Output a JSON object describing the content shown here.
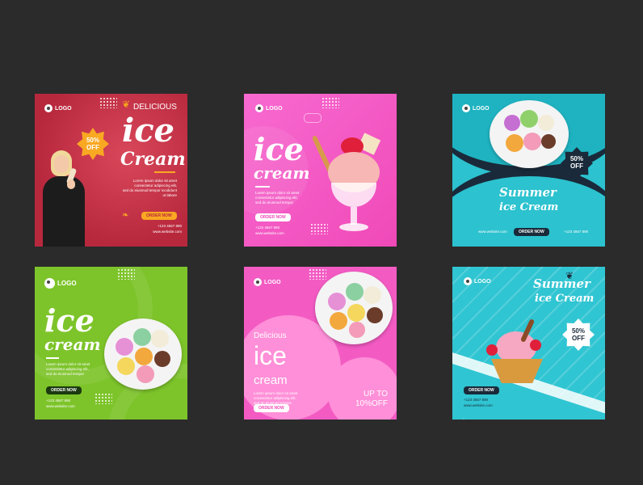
{
  "cards": [
    {
      "logo": "LOGO",
      "tag": "DELICIOUS",
      "badge_pct": "50%",
      "badge_off": "OFF",
      "title_1": "ice",
      "title_2": "Cream",
      "body_1": "Lorem ipsum dolor sit amet",
      "body_2": "consectetur adipiscing elit,",
      "body_3": "sed do eiusmod tempor incididunt",
      "body_4": "ut labore",
      "order": "ORDER NOW",
      "phone": "+123 4567 890",
      "website": "www.website.com"
    },
    {
      "logo": "LOGO",
      "title_1": "ice",
      "title_2": "cream",
      "body_1": "Lorem ipsum dolor sit amet",
      "body_2": "consectetur adipiscing elit,",
      "body_3": "sed do eiusmod tempor",
      "order": "ORDER NOW",
      "phone": "+123 4567 890",
      "website": "www.website.com"
    },
    {
      "logo": "LOGO",
      "badge_pct": "50%",
      "badge_off": "OFF",
      "title_1": "Summer",
      "title_2": "ice Cream",
      "website": "www.website.com",
      "order": "ORDER NOW",
      "phone": "+123 4567 890"
    },
    {
      "logo": "LOGO",
      "title_1": "ice",
      "title_2": "cream",
      "body_1": "Lorem ipsum dolor sit amet",
      "body_2": "consectetur adipiscing elit,",
      "body_3": "sed do eiusmod tempor",
      "order": "ORDER NOW",
      "phone": "+123 4567 890",
      "website": "www.website.com"
    },
    {
      "logo": "LOGO",
      "tag": "Delicious",
      "title_1": "ice",
      "title_2": "cream",
      "body_1": "Lorem ipsum dolor sit amet",
      "body_2": "consectetur adipiscing elit,",
      "body_3": "sed do eiusmod tempor",
      "promo_1": "UP TO",
      "promo_2": "10%OFF",
      "order": "ORDER NOW"
    },
    {
      "logo": "LOGO",
      "title_1": "Summer",
      "title_2": "ice Cream",
      "badge_pct": "50%",
      "badge_off": "OFF",
      "order": "ORDER NOW",
      "phone": "+123 4567 890",
      "website": "www.website.com"
    }
  ]
}
